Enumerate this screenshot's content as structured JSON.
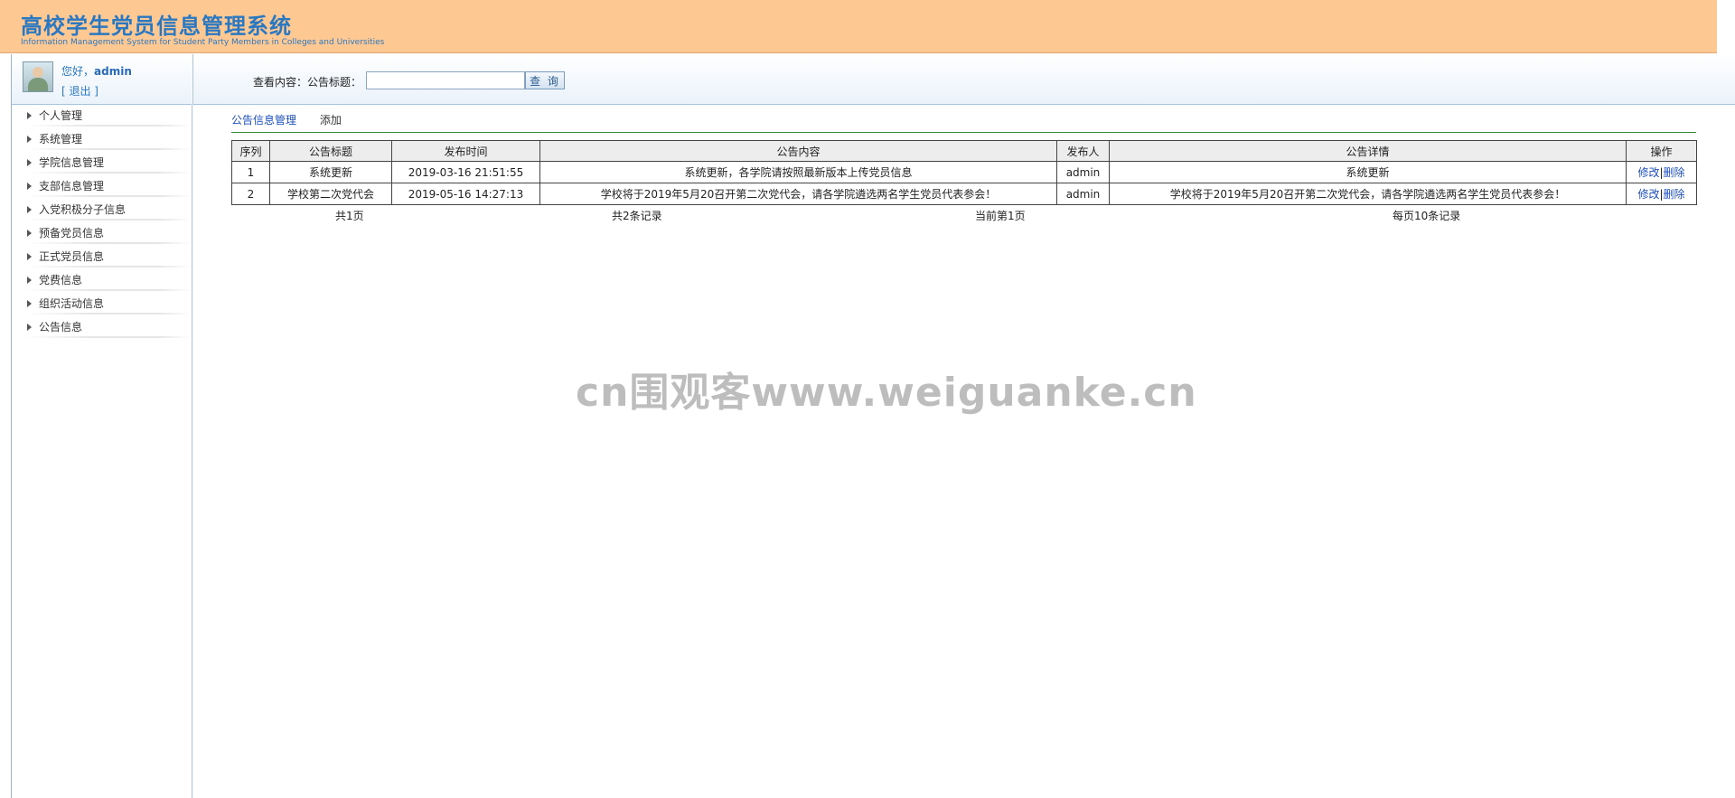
{
  "header": {
    "title": "高校学生党员信息管理系统",
    "subtitle": "Information Management System for Student Party Members in Colleges and Universities"
  },
  "user": {
    "greeting": "您好，",
    "name": "admin",
    "logout": "[ 退出 ]"
  },
  "search": {
    "label": "查看内容：公告标题：",
    "value": "",
    "button": "查 询"
  },
  "sidebar": {
    "items": [
      {
        "label": "个人管理"
      },
      {
        "label": "系统管理"
      },
      {
        "label": "学院信息管理"
      },
      {
        "label": "支部信息管理"
      },
      {
        "label": "入党积极分子信息"
      },
      {
        "label": "预备党员信息"
      },
      {
        "label": "正式党员信息"
      },
      {
        "label": "党费信息"
      },
      {
        "label": "组织活动信息"
      },
      {
        "label": "公告信息"
      }
    ]
  },
  "tabs": {
    "manage": "公告信息管理",
    "add": "添加"
  },
  "table": {
    "headers": [
      "序列",
      "公告标题",
      "发布时间",
      "公告内容",
      "发布人",
      "公告详情",
      "操作"
    ],
    "rows": [
      {
        "index": "1",
        "title": "系统更新",
        "time": "2019-03-16 21:51:55",
        "content": "系统更新，各学院请按照最新版本上传党员信息",
        "publisher": "admin",
        "detail": "系统更新",
        "edit": "修改",
        "sep": "|",
        "delete": "删除"
      },
      {
        "index": "2",
        "title": "学校第二次党代会",
        "time": "2019-05-16 14:27:13",
        "content": "学校将于2019年5月20召开第二次党代会，请各学院遴选两名学生党员代表参会！",
        "publisher": "admin",
        "detail": "学校将于2019年5月20召开第二次党代会，请各学院遴选两名学生党员代表参会！",
        "edit": "修改",
        "sep": "|",
        "delete": "删除"
      }
    ]
  },
  "pager": {
    "total_pages": "共1页",
    "total_records": "共2条记录",
    "current_page": "当前第1页",
    "per_page": "每页10条记录"
  },
  "watermark": "cn围观客www.weiguanke.cn"
}
